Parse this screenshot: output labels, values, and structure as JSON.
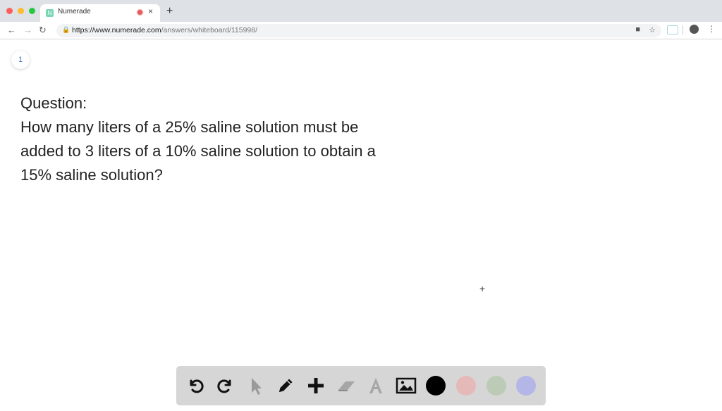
{
  "browser": {
    "tab_title": "Numerade",
    "favicon_letter": "N",
    "new_tab_label": "+",
    "tab_close_label": "×",
    "url_host": "https://www.numerade.com",
    "url_path": "/answers/whiteboard/115998/"
  },
  "whiteboard": {
    "page_number": "1",
    "question_lines": [
      "Question:",
      "How many liters of a 25% saline solution must be",
      "added to 3 liters of a 10% saline solution to obtain a",
      "15% saline solution?"
    ],
    "cursor_symbol": "+"
  },
  "toolbar": {
    "tools": [
      "undo-icon",
      "redo-icon",
      "select-cursor-icon",
      "pencil-icon",
      "add-icon",
      "eraser-icon",
      "text-tool-icon",
      "image-icon"
    ],
    "colors": [
      "#000000",
      "#e6b9b9",
      "#bccbb6",
      "#b3b6e6"
    ]
  }
}
